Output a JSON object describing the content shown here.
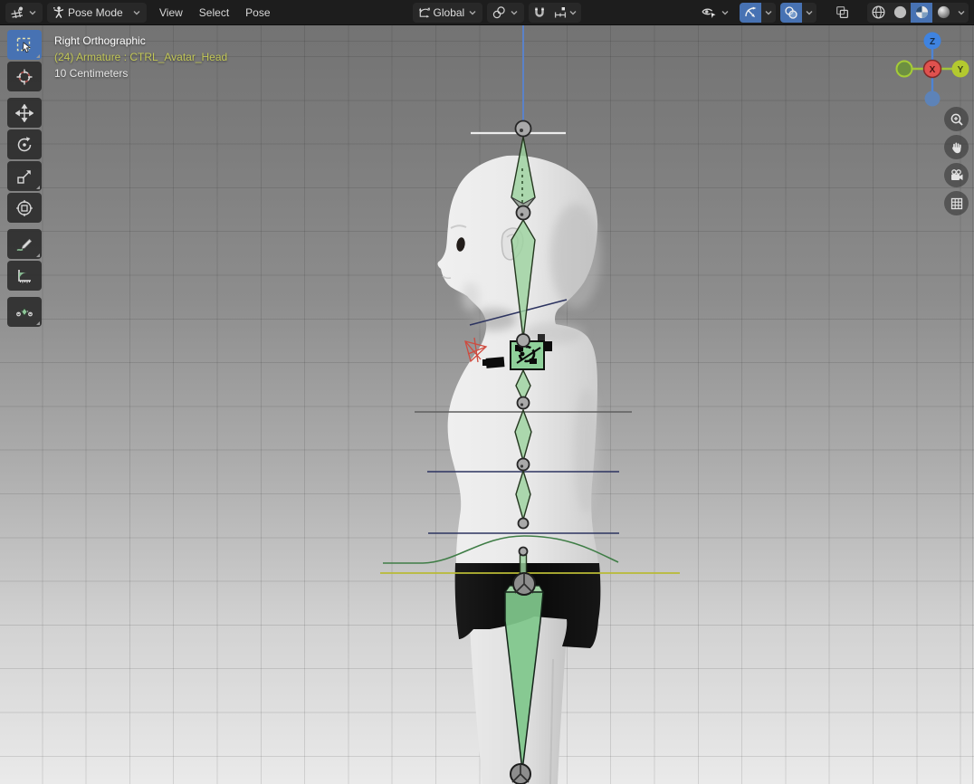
{
  "header": {
    "editor_type": "3D Viewport",
    "mode": {
      "label": "Pose Mode"
    },
    "menus": [
      "View",
      "Select",
      "Pose"
    ],
    "transform_orientation": {
      "label": "Global"
    },
    "snapping": {
      "enabled": false,
      "snap_to": "increment"
    },
    "toggles": {
      "gizmos_active": true,
      "overlays_active": true,
      "xray_active": false
    },
    "shading": {
      "modes": [
        "wireframe",
        "solid",
        "material-preview",
        "rendered"
      ],
      "active": "material-preview"
    }
  },
  "toolbar": {
    "tools": [
      {
        "name": "tweak-select-box",
        "active": true,
        "has_subtools": true
      },
      {
        "name": "cursor",
        "active": false,
        "has_subtools": false
      },
      {
        "name": "move",
        "active": false,
        "has_subtools": false
      },
      {
        "name": "rotate",
        "active": false,
        "has_subtools": false
      },
      {
        "name": "scale",
        "active": false,
        "has_subtools": true
      },
      {
        "name": "transform",
        "active": false,
        "has_subtools": false
      },
      {
        "name": "annotate",
        "active": false,
        "has_subtools": true
      },
      {
        "name": "measure",
        "active": false,
        "has_subtools": false
      },
      {
        "name": "pose-breakdowner",
        "active": false,
        "has_subtools": true
      }
    ]
  },
  "viewport": {
    "text": {
      "line1": "Right Orthographic",
      "line2": "(24) Armature : CTRL_Avatar_Head",
      "line3": "10 Centimeters"
    },
    "axis_gizmo": {
      "x": "X",
      "y": "Y",
      "z": "Z"
    },
    "nav_buttons": [
      "zoom",
      "pan",
      "camera-view",
      "toggle-perspective"
    ],
    "grid_unit": "10 Centimeters"
  },
  "colors": {
    "accent": "#4772b3",
    "bone_green": "#8fd19b",
    "selection_text": "#c3c857",
    "axis_x": "#e0514e",
    "axis_y": "#b3c92f",
    "axis_z": "#3f83e0",
    "yellow_line": "#b9ba35",
    "navy_line": "#2d3460"
  }
}
